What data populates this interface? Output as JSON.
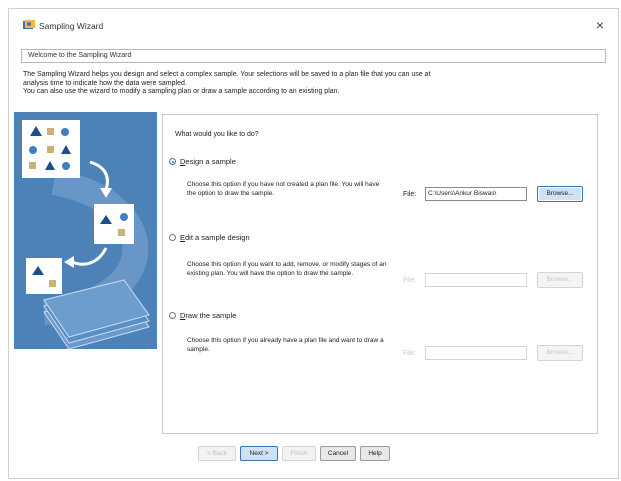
{
  "window": {
    "title": "Sampling Wizard",
    "close_glyph": "×"
  },
  "welcome": "Welcome to the Sampling Wizard",
  "intro": {
    "line1": "The Sampling Wizard helps you design and select a complex sample. Your selections will be saved to a plan file that you can use at",
    "line2": "analysis time to indicate how the data were sampled.",
    "line3": "You can also use the wizard to modify a sampling plan or draw a sample according to an existing plan."
  },
  "question": "What would you like to do?",
  "options": [
    {
      "label": "Design a sample",
      "description": "Choose this option if you have not created a plan file. You will have the option to draw the sample.",
      "selected": true,
      "file_label": "File:",
      "file_value": "C:\\Users\\Ankur Biswas\\",
      "browse_label": "Browse..."
    },
    {
      "label": "Edit a sample design",
      "description": "Choose this option if you want to add, remove, or modify stages of an existing plan. You will have the option to draw the sample.",
      "selected": false,
      "file_label": "File:",
      "file_value": "",
      "browse_label": "Browse..."
    },
    {
      "label": "Draw the sample",
      "description": "Choose this option if you already have a plan file and want to draw a sample.",
      "selected": false,
      "file_label": "File:",
      "file_value": "",
      "browse_label": "Browse..."
    }
  ],
  "buttons": {
    "back": "< Back",
    "next": "Next >",
    "finish": "Finish",
    "cancel": "Cancel",
    "help": "Help"
  },
  "colors": {
    "side_panel": "#4d82b8",
    "accent": "#3a73b8"
  }
}
